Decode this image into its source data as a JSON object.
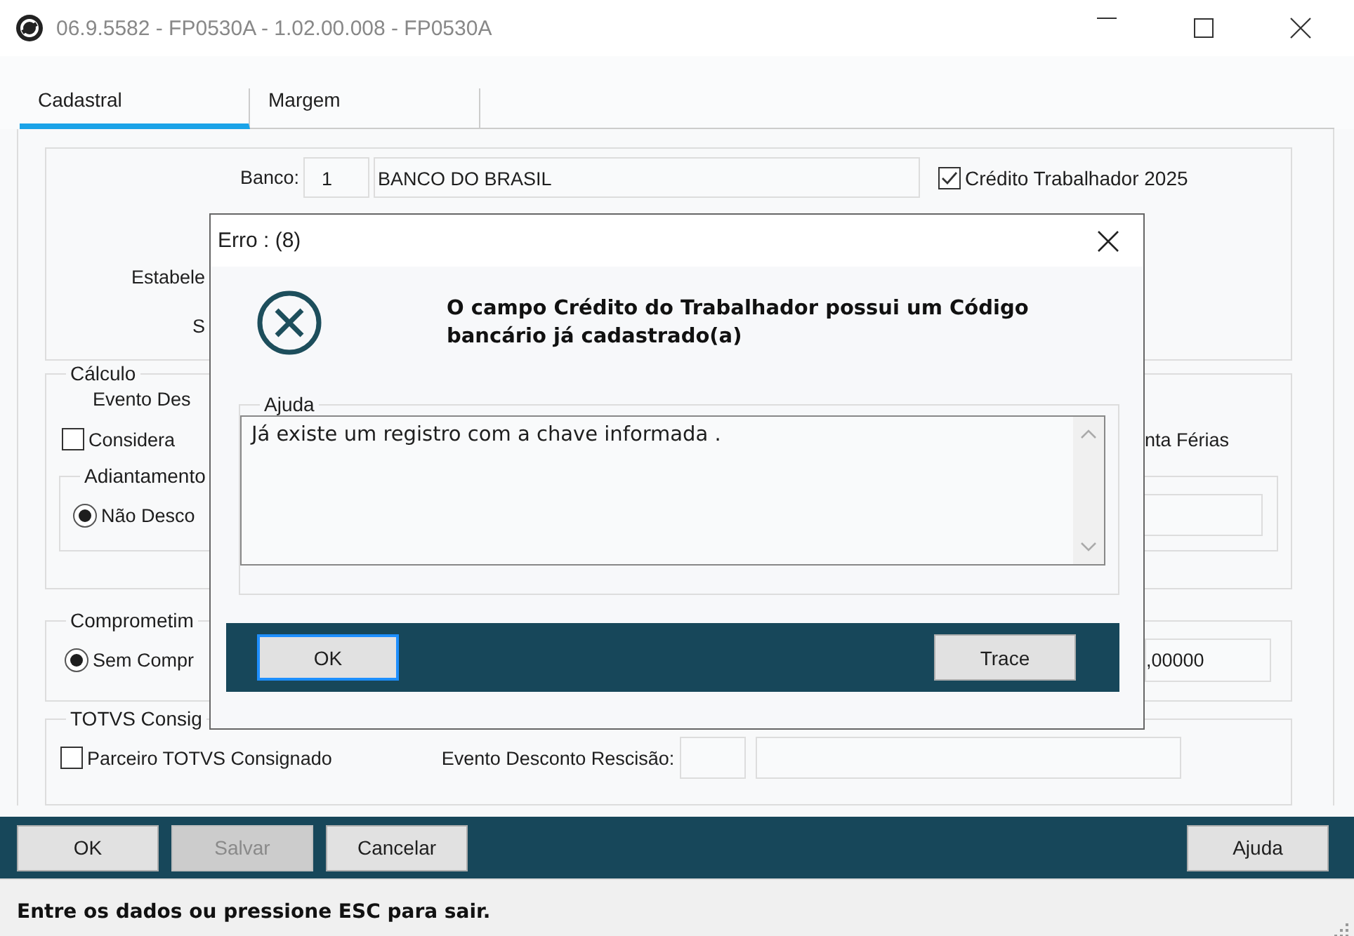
{
  "window": {
    "title": "06.9.5582 - FP0530A - 1.02.00.008 - FP0530A"
  },
  "tabs": [
    {
      "label": "Cadastral",
      "selected": true
    },
    {
      "label": "Margem",
      "selected": false
    }
  ],
  "form": {
    "bank": {
      "label": "Banco:",
      "code": "1",
      "name": "BANCO DO BRASIL"
    },
    "credit_checkbox": {
      "label": "Crédito Trabalhador 2025",
      "checked": true
    },
    "cut_labels": [
      "Estabele",
      "S"
    ],
    "calculo": {
      "title": "Cálculo",
      "event_label": "Evento Des",
      "checkbox": {
        "label": "Considera",
        "checked": false
      },
      "right_text": "nta Férias",
      "adiantamento": {
        "title": "Adiantamento",
        "radio": {
          "label": "Não Desco",
          "selected": true
        }
      }
    },
    "comprometimento": {
      "title": "Comprometim",
      "radio": {
        "label": "Sem Compr",
        "selected": true
      },
      "value": ",00000"
    },
    "totvs": {
      "title": "TOTVS Consig",
      "checkbox": {
        "label": "Parceiro TOTVS Consignado",
        "checked": false
      },
      "event_label": "Evento Desconto Rescisão:"
    }
  },
  "buttons": {
    "left": [
      {
        "label": "OK",
        "disabled": false
      },
      {
        "label": "Salvar",
        "disabled": true
      },
      {
        "label": "Cancelar",
        "disabled": false
      }
    ],
    "right": [
      {
        "label": "Ajuda",
        "disabled": false
      }
    ]
  },
  "status_bar": "Entre os dados ou pressione ESC para sair.",
  "dialog": {
    "title": "Erro : (8)",
    "message": "O campo Crédito do Trabalhador possui um Código bancário já cadastrado(a)",
    "help": {
      "title": "Ajuda",
      "text": "Já existe um registro com a chave informada ."
    },
    "buttons": {
      "left": [
        {
          "label": "OK",
          "focused": true
        }
      ],
      "right": [
        {
          "label": "Trace",
          "focused": false
        }
      ]
    }
  }
}
